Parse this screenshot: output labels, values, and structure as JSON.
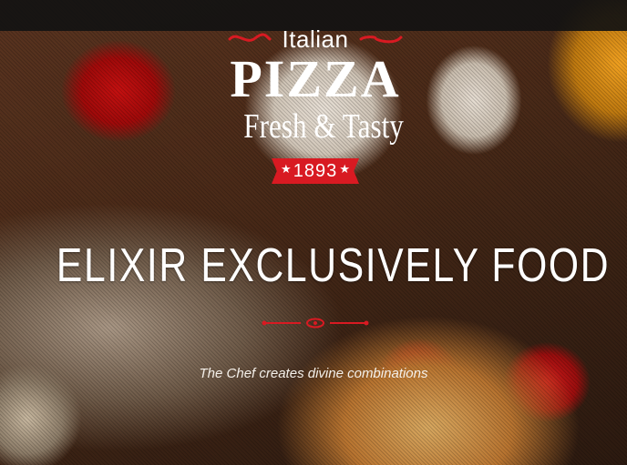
{
  "logo": {
    "italian": "Italian",
    "pizza": "PIZZA",
    "tagline": "Fresh & Tasty",
    "year": "1893",
    "accent_color": "#d81a22"
  },
  "hero": {
    "headline": "ELIXIR EXCLUSIVELY FOOD",
    "subtitle": "The Chef creates divine combinations",
    "divider_color": "#d81a22"
  },
  "icons": {
    "logo_swirl": "swirl-ornament-icon",
    "logo_star": "star-icon",
    "divider": "ornamental-divider-icon"
  }
}
